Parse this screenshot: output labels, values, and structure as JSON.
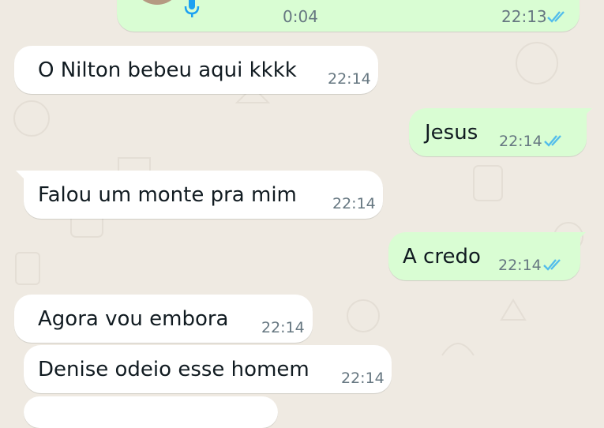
{
  "colors": {
    "outgoing_bubble": "#d9fdd3",
    "incoming_bubble": "#ffffff",
    "background": "#efeae2",
    "read_ticks": "#53bdeb",
    "mic_icon": "#1da1f2"
  },
  "voice_message": {
    "duration": "0:04",
    "time": "22:13",
    "status_icon": "double-check-icon"
  },
  "messages": [
    {
      "text": "O Nilton bebeu aqui kkkk",
      "time": "22:14",
      "direction": "incoming"
    },
    {
      "text": "Jesus",
      "time": "22:14",
      "direction": "outgoing",
      "status_icon": "double-check-icon"
    },
    {
      "text": "Falou um monte pra mim",
      "time": "22:14",
      "direction": "incoming"
    },
    {
      "text": "A credo",
      "time": "22:14",
      "direction": "outgoing",
      "status_icon": "double-check-icon"
    },
    {
      "text": "Agora vou embora",
      "time": "22:14",
      "direction": "incoming"
    },
    {
      "text": "Denise odeio esse homem",
      "time": "22:14",
      "direction": "incoming"
    }
  ]
}
